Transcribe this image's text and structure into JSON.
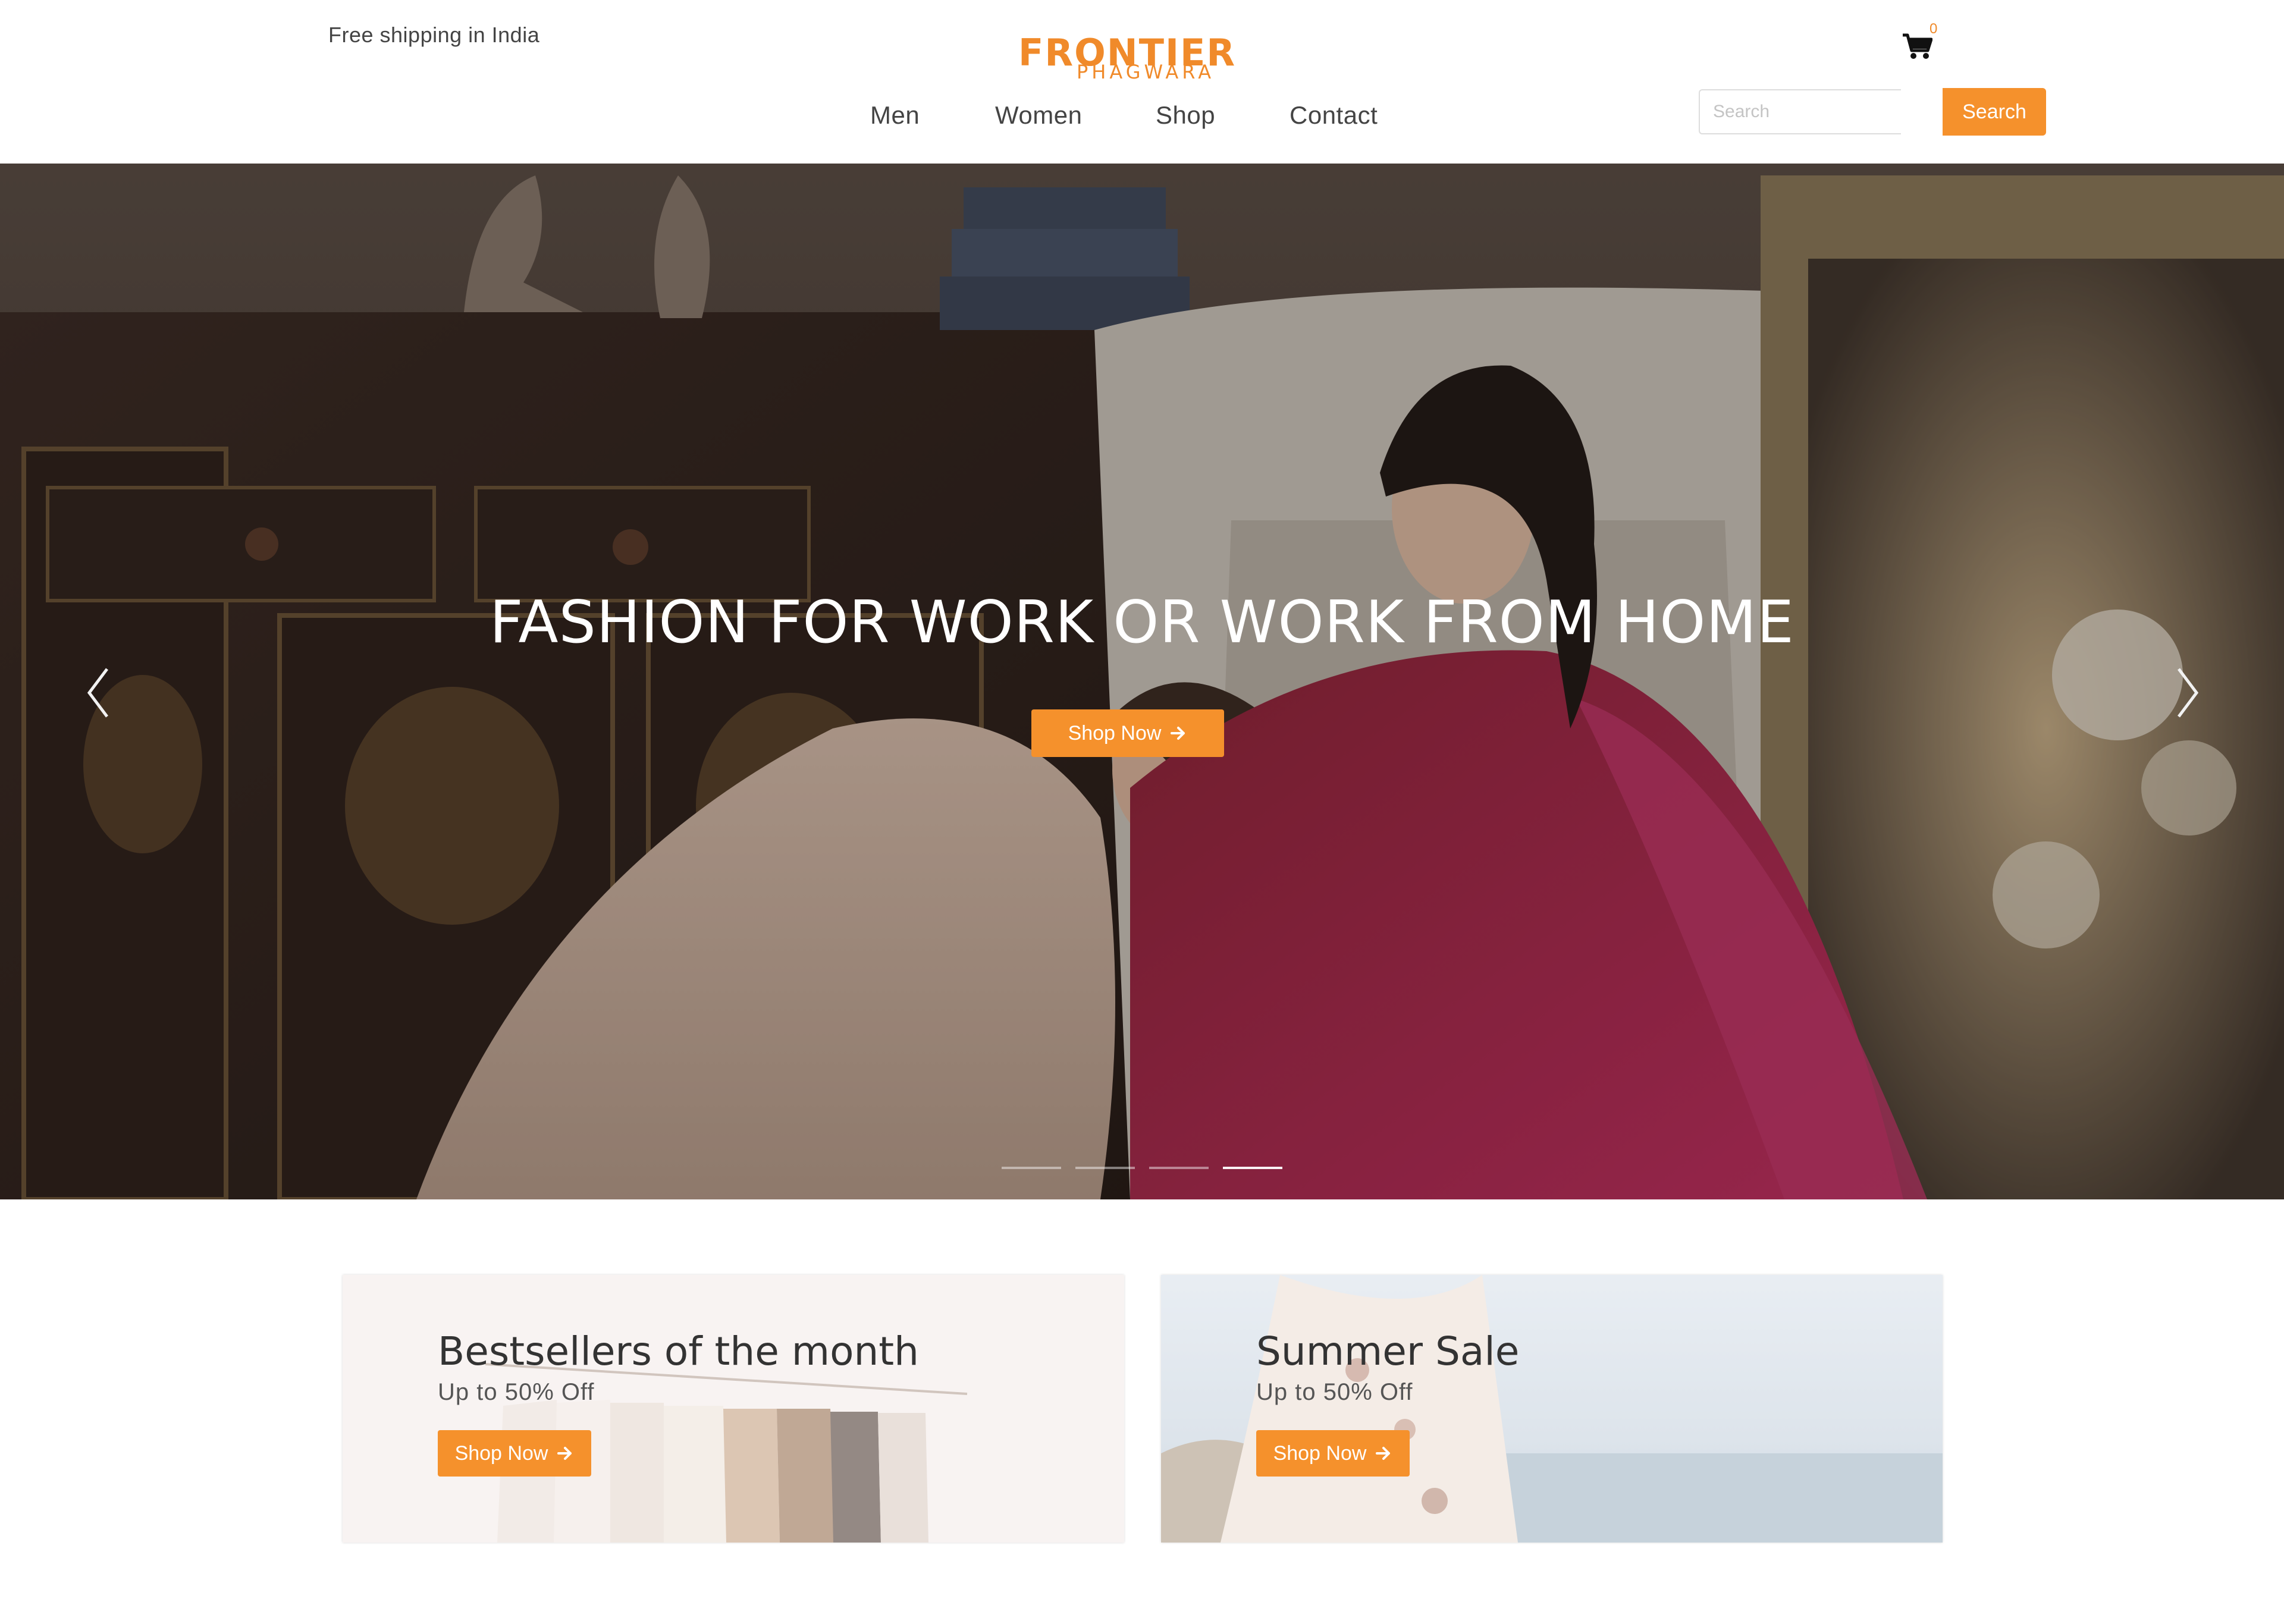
{
  "header": {
    "promo_text": "Free shipping in India",
    "logo": {
      "name": "FRONTIER",
      "tagline": "PHAGWARA"
    },
    "nav": [
      "Men",
      "Women",
      "Shop",
      "Contact"
    ],
    "cart": {
      "icon": "cart-icon",
      "count": "0"
    },
    "search": {
      "placeholder": "Search",
      "value": "",
      "button_label": "Search"
    }
  },
  "hero": {
    "headline": "FASHION FOR WORK OR WORK FROM HOME",
    "cta_label": "Shop Now",
    "cta_icon": "arrow-right-icon",
    "prev_icon": "chevron-left-icon",
    "next_icon": "chevron-right-icon",
    "slides_total": 4,
    "active_slide": 4
  },
  "promos": [
    {
      "title": "Bestsellers of the month",
      "subtitle": "Up to 50% Off",
      "cta_label": "Shop Now"
    },
    {
      "title": "Summer Sale",
      "subtitle": "Up to 50% Off",
      "cta_label": "Shop Now"
    }
  ],
  "colors": {
    "accent": "#f5912c",
    "logo": "#f08a2a"
  }
}
